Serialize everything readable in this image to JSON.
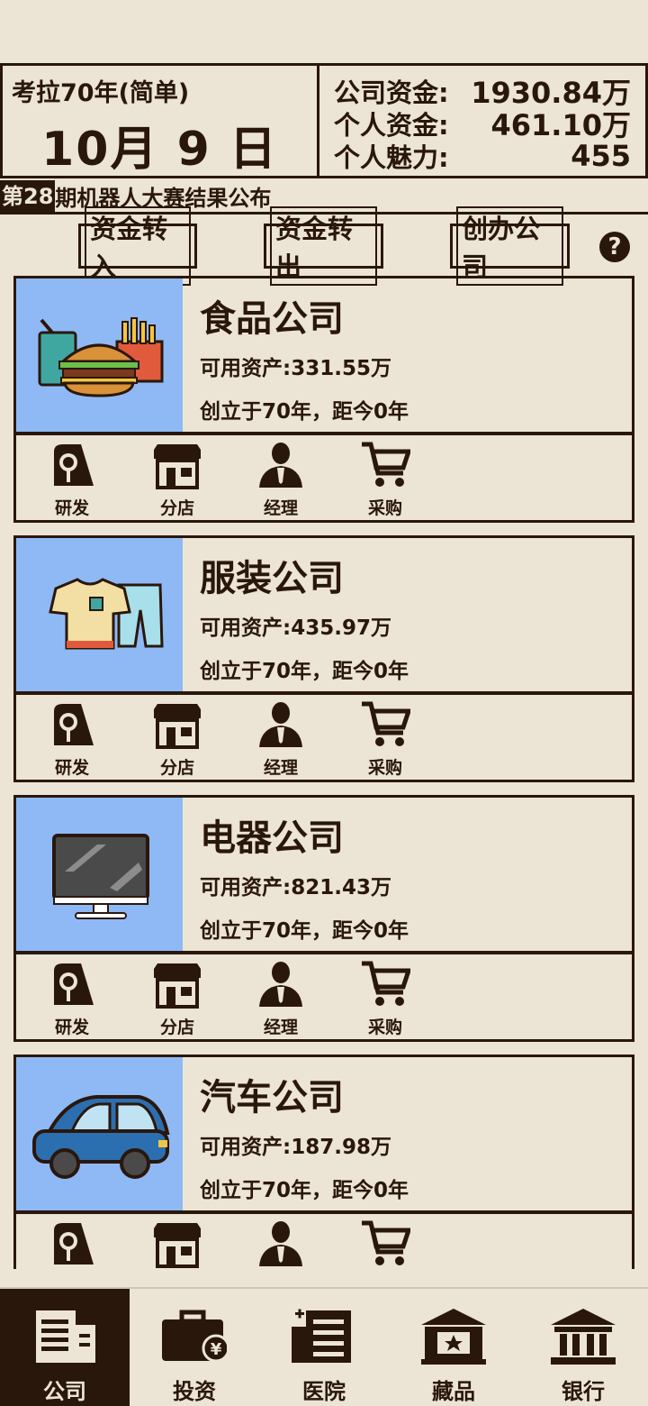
{
  "header": {
    "mode_label": "考拉70年(简单)",
    "date": "10月 9 日",
    "funds": [
      {
        "label": "公司资金:",
        "value": "1930.84万"
      },
      {
        "label": "个人资金:",
        "value": "461.10万"
      },
      {
        "label": "个人魅力:",
        "value": "455"
      }
    ]
  },
  "news": {
    "prefix": "第28",
    "text": "期机器人大赛结果公布"
  },
  "actions": {
    "transfer_in": "资金转入",
    "transfer_out": "资金转出",
    "found_company": "创办公司",
    "help": "?"
  },
  "companies": [
    {
      "name": "食品公司",
      "assets": "可用资产:331.55万",
      "founded": "创立于70年，距今0年",
      "icon": "burger-fries-drink-icon"
    },
    {
      "name": "服装公司",
      "assets": "可用资产:435.97万",
      "founded": "创立于70年，距今0年",
      "icon": "tshirt-pants-icon"
    },
    {
      "name": "电器公司",
      "assets": "可用资产:821.43万",
      "founded": "创立于70年，距今0年",
      "icon": "monitor-icon"
    },
    {
      "name": "汽车公司",
      "assets": "可用资产:187.98万",
      "founded": "创立于70年，距今0年",
      "icon": "car-icon"
    }
  ],
  "tools": [
    "研发",
    "分店",
    "经理",
    "采购"
  ],
  "nav": [
    {
      "label": "公司",
      "icon": "company-building-icon",
      "active": true
    },
    {
      "label": "投资",
      "icon": "briefcase-yen-icon",
      "active": false
    },
    {
      "label": "医院",
      "icon": "hospital-icon",
      "active": false
    },
    {
      "label": "藏品",
      "icon": "museum-star-icon",
      "active": false
    },
    {
      "label": "银行",
      "icon": "bank-icon",
      "active": false
    }
  ],
  "colors": {
    "background": "#ece4d5",
    "dark": "#2a170c",
    "card_image_bg": "#8fb9f5"
  }
}
